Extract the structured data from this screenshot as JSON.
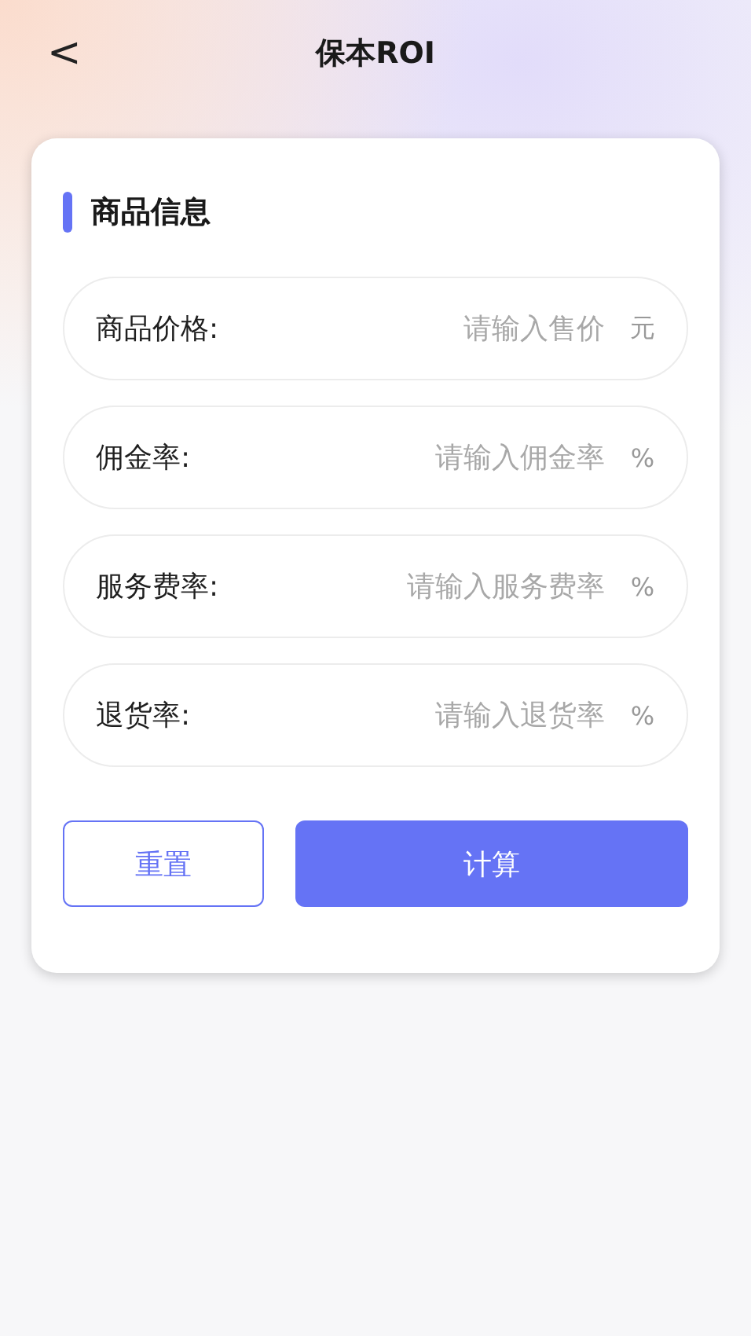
{
  "header": {
    "back": "<",
    "title": "保本ROI"
  },
  "section": {
    "title": "商品信息"
  },
  "fields": [
    {
      "label": "商品价格:",
      "placeholder": "请输入售价",
      "unit": "元"
    },
    {
      "label": "佣金率:",
      "placeholder": "请输入佣金率",
      "unit": "%"
    },
    {
      "label": "服务费率:",
      "placeholder": "请输入服务费率",
      "unit": "%"
    },
    {
      "label": "退货率:",
      "placeholder": "请输入退货率",
      "unit": "%"
    }
  ],
  "buttons": [
    {
      "label": "重置",
      "kind": "outline"
    },
    {
      "label": "计算",
      "kind": "primary"
    }
  ]
}
